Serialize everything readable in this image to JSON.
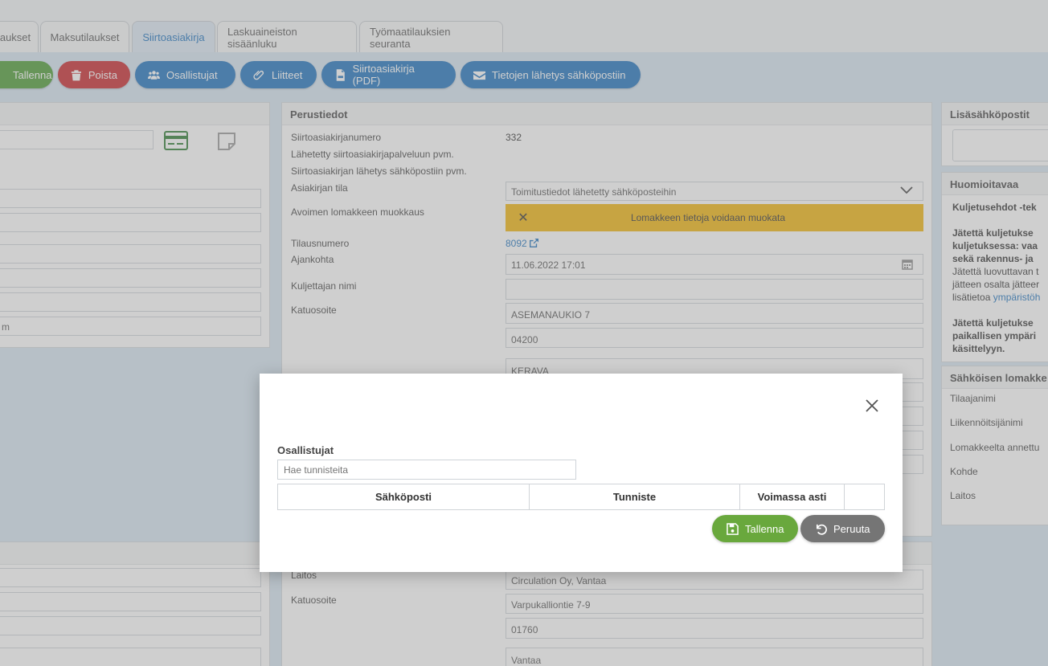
{
  "tabs": [
    {
      "label": "aukset"
    },
    {
      "label": "Maksutilaukset"
    },
    {
      "label": "Siirtoasiakirja",
      "active": true
    },
    {
      "label": "Laskuaineiston sisäänluku"
    },
    {
      "label": "Työmaatilauksien seuranta"
    }
  ],
  "toolbar": {
    "save": "Tallenna",
    "delete": "Poista",
    "participants": "Osallistujat",
    "attachments": "Liitteet",
    "pdf": "Siirtoasiakirja (PDF)",
    "email": "Tietojen lähetys sähköpostiin"
  },
  "left_panel": {
    "partial_value": "m"
  },
  "basic_info": {
    "title": "Perustiedot",
    "doc_number_label": "Siirtoasiakirjanumero",
    "doc_number": "332",
    "sent_service_label": "Lähetetty siirtoasiakirjapalveluun pvm.",
    "sent_email_label": "Siirtoasiakirjan lähetys sähköpostiin pvm.",
    "status_label": "Asiakirjan tila",
    "status_value": "Toimitustiedot lähetetty sähköposteihin",
    "open_edit_label": "Avoimen lomakkeen muokkaus",
    "open_edit_value": "Lomakkeen tietoja voidaan muokata",
    "order_number_label": "Tilausnumero",
    "order_number": "8092",
    "time_label": "Ajankohta",
    "time_value": "11.06.2022 17:01",
    "driver_label": "Kuljettajan nimi",
    "driver_value": "",
    "street_label": "Katuosoite",
    "street_value": "ASEMANAUKIO 7",
    "postal_value": "04200",
    "city_value": "KERAVA"
  },
  "facility": {
    "facility_label": "Laitos",
    "facility_value": "Circulation Oy, Vantaa",
    "street_label": "Katuosoite",
    "street_value": "Varpukalliontie 7-9",
    "postal_value": "01760",
    "city_value": "Vantaa"
  },
  "right_panel": {
    "extra_emails_title": "Lisäsähköpostit",
    "notes_title": "Huomioitavaa",
    "notes_heading": "Kuljetusehdot -tek",
    "notes_p1_line1": "Jätettä kuljetukse",
    "notes_p1_line2": "kuljetuksessa: vaa",
    "notes_p1_line3": "sekä rakennus- ja",
    "notes_p2_line1": "Jätettä luovuttavan t",
    "notes_p2_line2": "jätteen osalta jätteer",
    "notes_p2_line3_prefix": "lisätietoa",
    "notes_p2_line3_link": "ympäristöh",
    "notes_p3_line1": "Jätettä kuljetukse",
    "notes_p3_line2": "paikallisen ympäri",
    "notes_p3_line3": "käsittelyyn.",
    "eform_title": "Sähköisen lomakke",
    "eform_items": [
      "Tilaajanimi",
      "Liikennöitsijänimi",
      "Lomakkeelta annettu",
      "Kohde",
      "Laitos"
    ]
  },
  "modal": {
    "title": "Osallistujat",
    "search_placeholder": "Hae tunnisteita",
    "columns": [
      "Sähköposti",
      "Tunniste",
      "Voimassa asti",
      ""
    ],
    "save": "Tallenna",
    "cancel": "Peruuta"
  },
  "colors": {
    "green": "#4c9b35",
    "red": "#c8262b",
    "blue": "#1e73be",
    "warning": "#f2b50d",
    "grey_button": "#6e6e6e"
  }
}
